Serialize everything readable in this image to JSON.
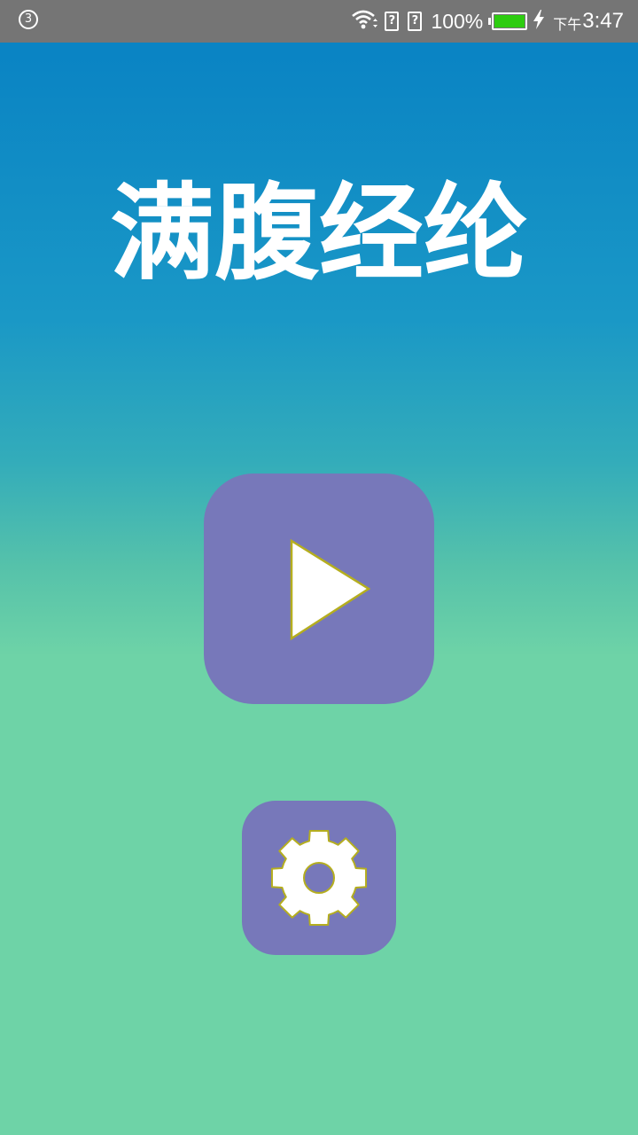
{
  "status_bar": {
    "notification_count": "3",
    "icons": [
      "wifi-icon",
      "sim-unknown-icon",
      "sim-unknown-icon",
      "battery-icon",
      "charging-icon"
    ],
    "sim_slot_1": "?",
    "sim_slot_2": "?",
    "battery_percent": "100%",
    "battery_level": 1.0,
    "battery_color": "#2dcc10",
    "clock_ampm": "下午",
    "clock_time": "3:47"
  },
  "main": {
    "title": "满腹经纶",
    "play_button_icon": "play-icon",
    "settings_button_icon": "gear-icon"
  },
  "colors": {
    "button_bg": "#7778ba",
    "icon_outline": "#b5ae1f",
    "gradient_top": "#0a84c4",
    "gradient_bottom": "#6ed3a7"
  }
}
